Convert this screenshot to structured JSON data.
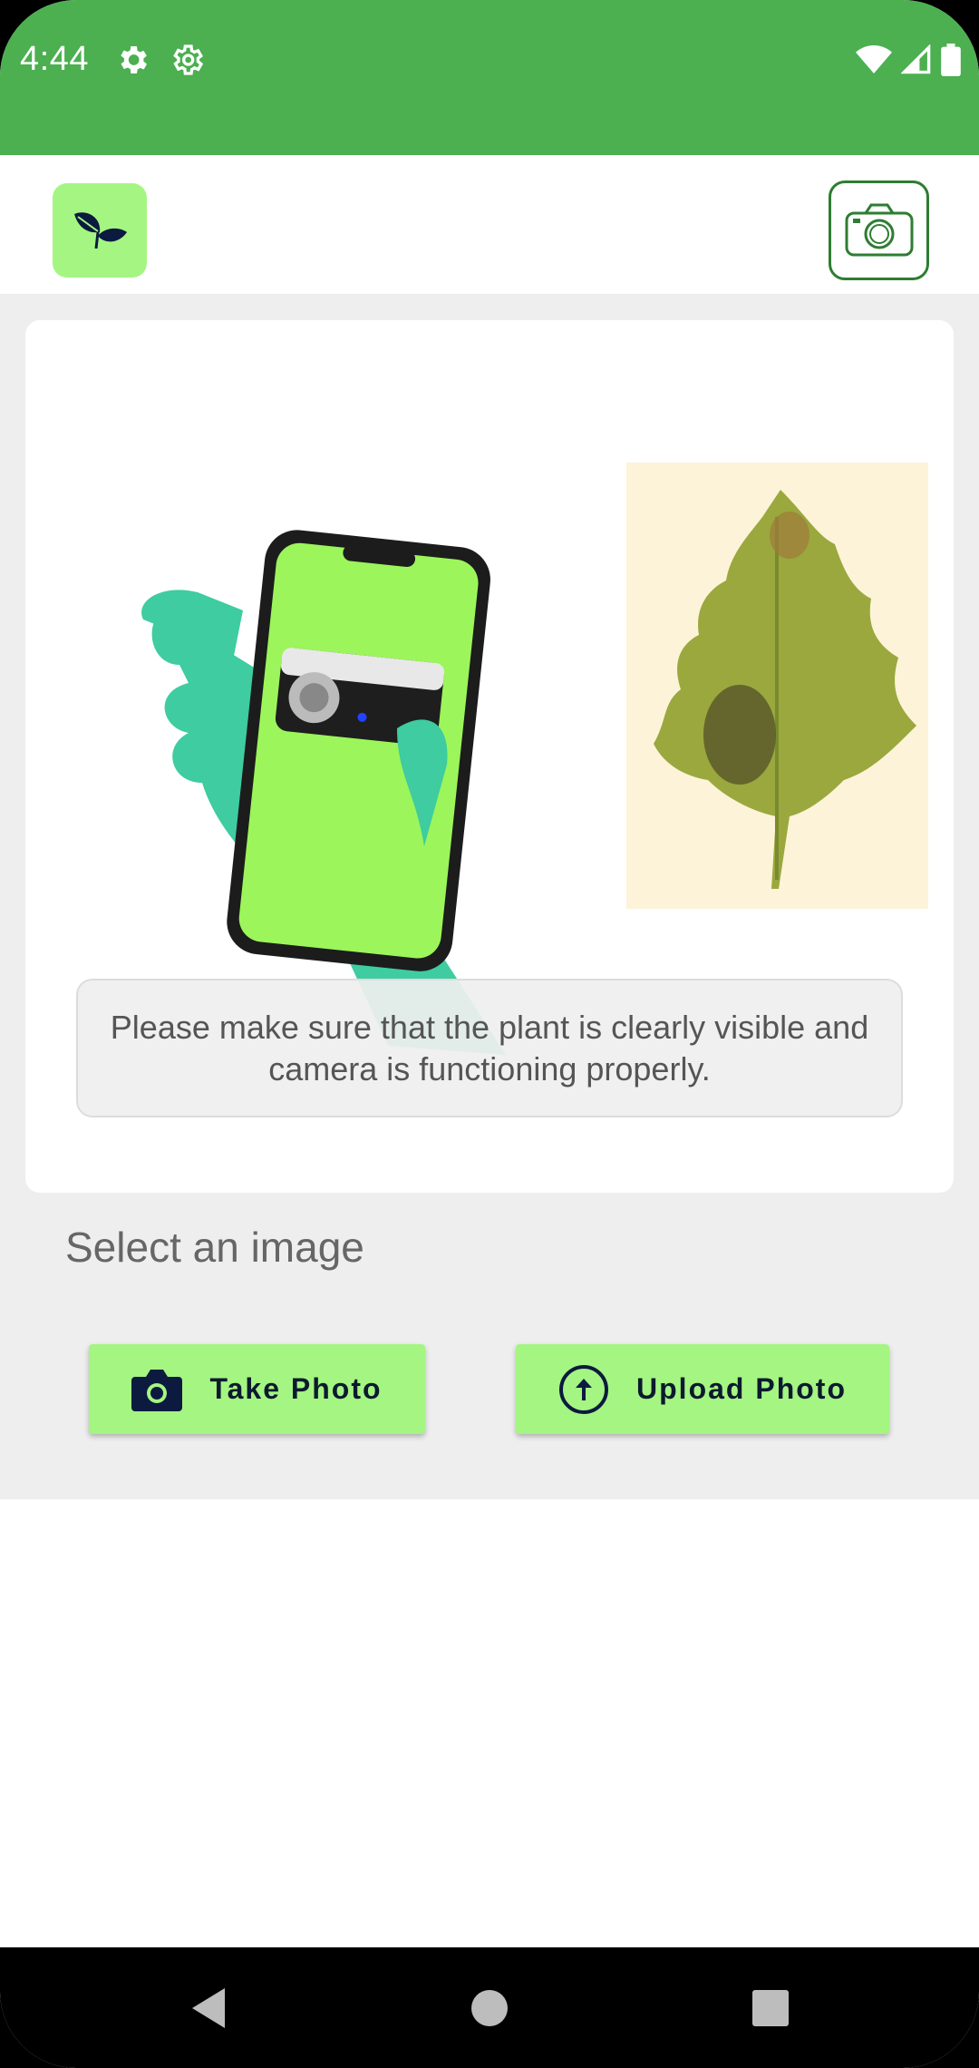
{
  "status_bar": {
    "time": "4:44",
    "left_icons": [
      "gear-icon",
      "settings-icon"
    ],
    "right_icons": [
      "wifi-icon",
      "signal-icon",
      "battery-icon"
    ],
    "background": "#4caf50"
  },
  "app_bar": {
    "logo_icon": "leaf-icon",
    "logo_background": "#a5f582",
    "action_icon": "camera-icon",
    "action_border": "#2e7d32"
  },
  "instruction_card": {
    "illustration": "hand-holding-phone-and-leaf",
    "notice_text": "Please make sure that the plant is clearly visible and camera is functioning properly."
  },
  "image_picker": {
    "label": "Select an image",
    "take_photo": {
      "label": "Take Photo",
      "icon": "camera-icon"
    },
    "upload_photo": {
      "label": "Upload Photo",
      "icon": "upload-icon"
    },
    "button_color": "#a5f582"
  },
  "nav_bar": {
    "items": [
      "back-icon",
      "home-icon",
      "recents-icon"
    ]
  }
}
